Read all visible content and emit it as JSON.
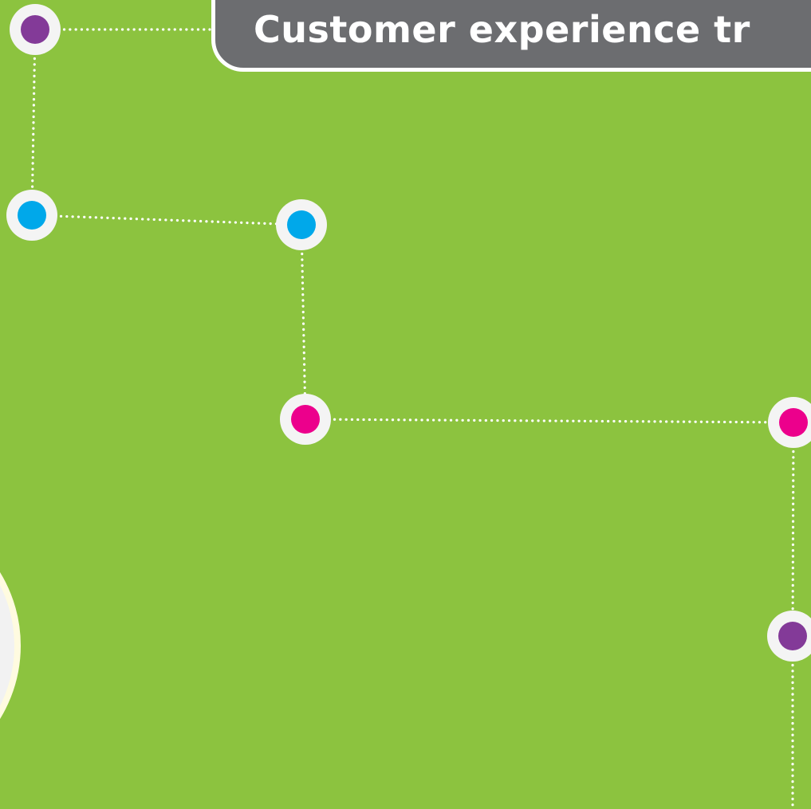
{
  "title": "Customer experience tr",
  "colors": {
    "background": "#8cc33f",
    "connector": "#ffffff",
    "node_ring": "#f4f4f4",
    "title_bg": "#6c6d70",
    "title_text": "#ffffff",
    "purple": "#833a98",
    "blue": "#00a8ea",
    "magenta": "#ec008c",
    "partial_circle_fill": "#f2f2f2",
    "partial_circle_ring": "#fffbe0"
  },
  "nodes": [
    {
      "id": "node-1",
      "color": "purple"
    },
    {
      "id": "node-2",
      "color": "blue"
    },
    {
      "id": "node-3",
      "color": "blue"
    },
    {
      "id": "node-4",
      "color": "magenta"
    },
    {
      "id": "node-5",
      "color": "magenta"
    },
    {
      "id": "node-6",
      "color": "purple"
    }
  ],
  "connections": [
    {
      "from": "node-1",
      "to": "title"
    },
    {
      "from": "node-1",
      "to": "node-2"
    },
    {
      "from": "node-2",
      "to": "node-3"
    },
    {
      "from": "node-3",
      "to": "node-4"
    },
    {
      "from": "node-4",
      "to": "node-5"
    },
    {
      "from": "node-5",
      "to": "node-6"
    },
    {
      "from": "node-6",
      "to": "offscreen-bottom"
    }
  ]
}
